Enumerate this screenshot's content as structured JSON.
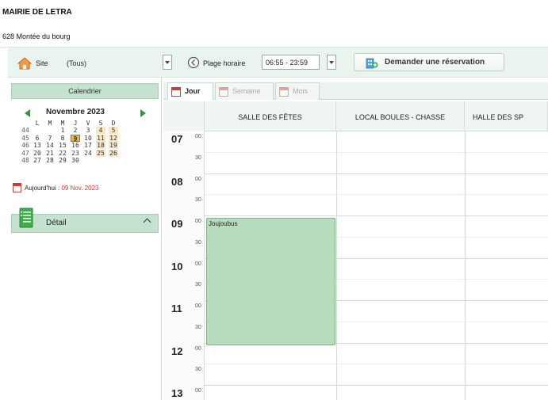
{
  "org": {
    "name": "MAIRIE DE LETRA",
    "address": "628 Montée du bourg"
  },
  "toolbar": {
    "site_label": "Site",
    "site_value": "(Tous)",
    "time_range_label": "Plage horaire",
    "time_range_value": "06:55 - 23:59",
    "request_button": "Demander une réservation"
  },
  "sidebar": {
    "calendar_title": "Calendrier",
    "month_title": "Novembre 2023",
    "weekdays": [
      "L",
      "M",
      "M",
      "J",
      "V",
      "S",
      "D"
    ],
    "weeks": [
      {
        "num": "44",
        "days": [
          "",
          "",
          "1",
          "2",
          "3",
          "4",
          "5"
        ]
      },
      {
        "num": "45",
        "days": [
          "6",
          "7",
          "8",
          "9",
          "10",
          "11",
          "12"
        ]
      },
      {
        "num": "46",
        "days": [
          "13",
          "14",
          "15",
          "16",
          "17",
          "18",
          "19"
        ]
      },
      {
        "num": "47",
        "days": [
          "20",
          "21",
          "22",
          "23",
          "24",
          "25",
          "26"
        ]
      },
      {
        "num": "48",
        "days": [
          "27",
          "28",
          "29",
          "30",
          "",
          "",
          ""
        ]
      }
    ],
    "today_label": "Aujourd'hui :",
    "today_date": "09 Nov. 2023",
    "detail_label": "Détail"
  },
  "tabs": [
    {
      "label": "Jour",
      "active": true
    },
    {
      "label": "Semaine",
      "active": false
    },
    {
      "label": "Mois",
      "active": false
    }
  ],
  "columns": [
    "SALLE DES FÊTES",
    "LOCAL BOULES - CHASSE",
    "HALLE DES SP"
  ],
  "hours": [
    "07",
    "08",
    "09",
    "10",
    "11",
    "12",
    "13"
  ],
  "minute_marks": {
    "top": "00",
    "half": "30"
  },
  "event": {
    "title": "Joujoubus"
  },
  "colors": {
    "accent_green": "#c5e2cf",
    "event_green": "#b7dcbb",
    "today_orange": "#f7b62f",
    "today_red": "#d9362f"
  }
}
